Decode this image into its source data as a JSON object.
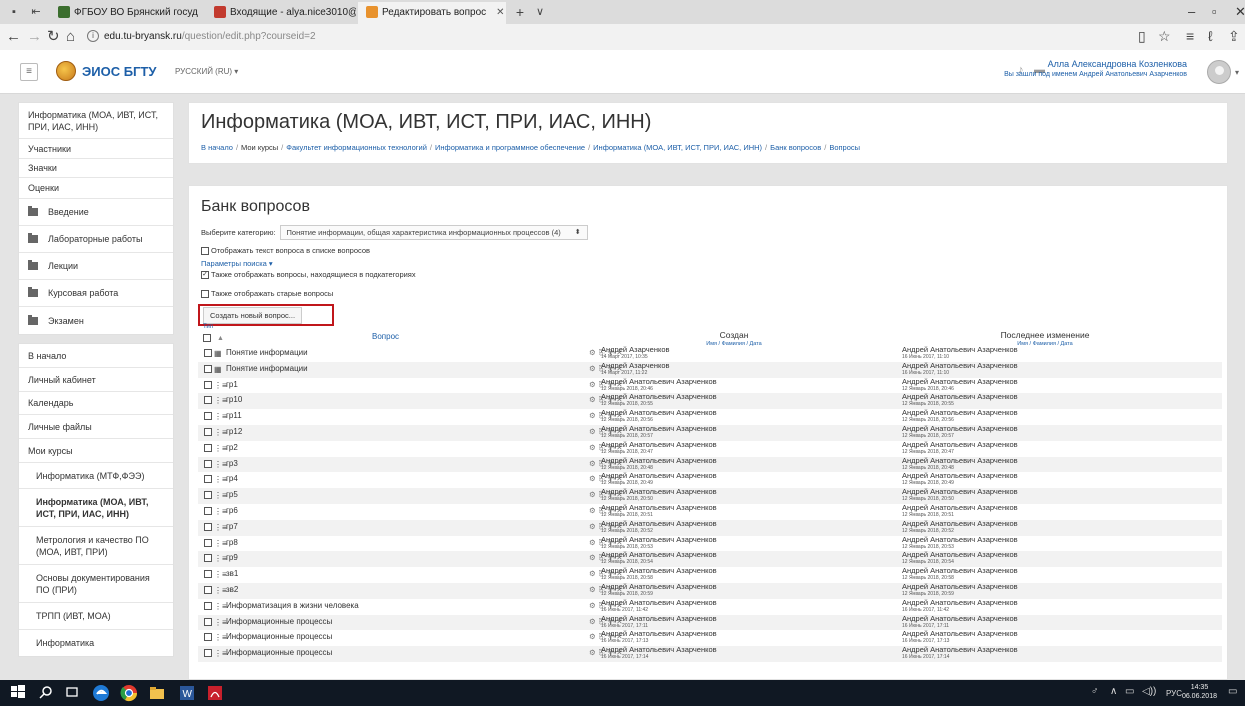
{
  "browser": {
    "tabs": [
      {
        "label": "ФГБОУ ВО Брянский госуд",
        "color": "#3b6e2e"
      },
      {
        "label": "Входящие - alya.nice3010@",
        "color": "#c23a2e"
      },
      {
        "label": "Редактировать вопрос",
        "color": "#e8922d"
      }
    ],
    "new_tab": "+",
    "tab_menu": "∨",
    "url_host": "edu.tu-bryansk.ru",
    "url_path": "/question/edit.php?courseid=2"
  },
  "navbar": {
    "menu_icon": "≡",
    "site_name": "ЭИОС БГТУ",
    "language": "РУССКИЙ (RU) ▾",
    "user_name": "Алла Александровна Козленкова",
    "logged_as": "Вы зашли под именем Андрей Анатольевич Азарченков"
  },
  "sidebar": {
    "course_block": [
      {
        "label": "Информатика (МОА, ИВТ, ИСТ, ПРИ, ИАС, ИНН)",
        "folder": false
      },
      {
        "label": "Участники",
        "folder": false
      },
      {
        "label": "Значки",
        "folder": false
      },
      {
        "label": "Оценки",
        "folder": false
      },
      {
        "label": "Введение",
        "folder": true
      },
      {
        "label": "Лабораторные работы",
        "folder": true
      },
      {
        "label": "Лекции",
        "folder": true
      },
      {
        "label": "Курсовая работа",
        "folder": true
      },
      {
        "label": "Экзамен",
        "folder": true
      }
    ],
    "site_block": [
      {
        "label": "В начало",
        "sub": false,
        "bold": false
      },
      {
        "label": "Личный кабинет",
        "sub": false,
        "bold": false
      },
      {
        "label": "Календарь",
        "sub": false,
        "bold": false
      },
      {
        "label": "Личные файлы",
        "sub": false,
        "bold": false
      },
      {
        "label": "Мои курсы",
        "sub": false,
        "bold": false
      },
      {
        "label": "Информатика (МТФ,ФЭЭ)",
        "sub": true,
        "bold": false
      },
      {
        "label": "Информатика (МОА, ИВТ, ИСТ, ПРИ, ИАС, ИНН)",
        "sub": true,
        "bold": true
      },
      {
        "label": "Метрология и качество ПО (МОА, ИВТ, ПРИ)",
        "sub": true,
        "bold": false
      },
      {
        "label": "Основы документирования ПО (ПРИ)",
        "sub": true,
        "bold": false
      },
      {
        "label": "ТРПП (ИВТ, МОА)",
        "sub": true,
        "bold": false
      },
      {
        "label": "Информатика",
        "sub": true,
        "bold": false
      }
    ]
  },
  "header": {
    "title": "Информатика (МОА, ИВТ, ИСТ, ПРИ, ИАС, ИНН)",
    "breadcrumb": [
      "В начало",
      "Мои курсы",
      "Факультет информационных технологий",
      "Информатика и программное обеспечение",
      "Информатика (МОА, ИВТ, ИСТ, ПРИ, ИАС, ИНН)",
      "Банк вопросов",
      "Вопросы"
    ]
  },
  "bank": {
    "title": "Банк вопросов",
    "category_label": "Выберите категорию:",
    "category_value": "Понятие информации, общая характеристика информационных процессов (4)",
    "show_text": "Отображать текст вопроса в списке вопросов",
    "search_params": "Параметры поиска ▾",
    "include_sub": "Также отображать вопросы, находящиеся в подкатегориях",
    "include_old": "Также отображать старые вопросы",
    "create_button": "Создать новый вопрос...",
    "col_type": "Тип",
    "col_question": "Вопрос",
    "col_created": "Создан",
    "col_created_sub": "Имя / Фамилия / Дата",
    "col_modified": "Последнее изменение",
    "col_modified_sub": "Имя / Фамилия / Дата"
  },
  "questions": [
    {
      "name": "Понятие информации",
      "type": "ddwtos",
      "created_by": "Андрей Азарченков",
      "created": "14 Март 2017, 10:35",
      "modified_by": "Андрей Анатольевич Азарченков",
      "modified": "16 Июнь 2017, 11:10"
    },
    {
      "name": "Понятие информации",
      "type": "ddwtos",
      "created_by": "Андрей Азарченков",
      "created": "14 Март 2017, 11:22",
      "modified_by": "Андрей Анатольевич Азарченков",
      "modified": "16 Июнь 2017, 11:10"
    },
    {
      "name": "гр1",
      "type": "match",
      "created_by": "Андрей Анатольевич Азарченков",
      "created": "12 Январь 2018, 20:46",
      "modified_by": "Андрей Анатольевич Азарченков",
      "modified": "12 Январь 2018, 20:46"
    },
    {
      "name": "гр10",
      "type": "match",
      "created_by": "Андрей Анатольевич Азарченков",
      "created": "12 Январь 2018, 20:55",
      "modified_by": "Андрей Анатольевич Азарченков",
      "modified": "12 Январь 2018, 20:55"
    },
    {
      "name": "гр11",
      "type": "match",
      "created_by": "Андрей Анатольевич Азарченков",
      "created": "12 Январь 2018, 20:56",
      "modified_by": "Андрей Анатольевич Азарченков",
      "modified": "12 Январь 2018, 20:56"
    },
    {
      "name": "гр12",
      "type": "match",
      "created_by": "Андрей Анатольевич Азарченков",
      "created": "12 Январь 2018, 20:57",
      "modified_by": "Андрей Анатольевич Азарченков",
      "modified": "12 Январь 2018, 20:57"
    },
    {
      "name": "гр2",
      "type": "match",
      "created_by": "Андрей Анатольевич Азарченков",
      "created": "12 Январь 2018, 20:47",
      "modified_by": "Андрей Анатольевич Азарченков",
      "modified": "12 Январь 2018, 20:47"
    },
    {
      "name": "гр3",
      "type": "match",
      "created_by": "Андрей Анатольевич Азарченков",
      "created": "12 Январь 2018, 20:48",
      "modified_by": "Андрей Анатольевич Азарченков",
      "modified": "12 Январь 2018, 20:48"
    },
    {
      "name": "гр4",
      "type": "match",
      "created_by": "Андрей Анатольевич Азарченков",
      "created": "12 Январь 2018, 20:49",
      "modified_by": "Андрей Анатольевич Азарченков",
      "modified": "12 Январь 2018, 20:49"
    },
    {
      "name": "гр5",
      "type": "match",
      "created_by": "Андрей Анатольевич Азарченков",
      "created": "12 Январь 2018, 20:50",
      "modified_by": "Андрей Анатольевич Азарченков",
      "modified": "12 Январь 2018, 20:50"
    },
    {
      "name": "гр6",
      "type": "match",
      "created_by": "Андрей Анатольевич Азарченков",
      "created": "12 Январь 2018, 20:51",
      "modified_by": "Андрей Анатольевич Азарченков",
      "modified": "12 Январь 2018, 20:51"
    },
    {
      "name": "гр7",
      "type": "match",
      "created_by": "Андрей Анатольевич Азарченков",
      "created": "12 Январь 2018, 20:52",
      "modified_by": "Андрей Анатольевич Азарченков",
      "modified": "12 Январь 2018, 20:52"
    },
    {
      "name": "гр8",
      "type": "match",
      "created_by": "Андрей Анатольевич Азарченков",
      "created": "12 Январь 2018, 20:53",
      "modified_by": "Андрей Анатольевич Азарченков",
      "modified": "12 Январь 2018, 20:53"
    },
    {
      "name": "гр9",
      "type": "match",
      "created_by": "Андрей Анатольевич Азарченков",
      "created": "12 Январь 2018, 20:54",
      "modified_by": "Андрей Анатольевич Азарченков",
      "modified": "12 Январь 2018, 20:54"
    },
    {
      "name": "зв1",
      "type": "match",
      "created_by": "Андрей Анатольевич Азарченков",
      "created": "12 Январь 2018, 20:58",
      "modified_by": "Андрей Анатольевич Азарченков",
      "modified": "12 Январь 2018, 20:58"
    },
    {
      "name": "зв2",
      "type": "match",
      "created_by": "Андрей Анатольевич Азарченков",
      "created": "12 Январь 2018, 20:59",
      "modified_by": "Андрей Анатольевич Азарченков",
      "modified": "12 Январь 2018, 20:59"
    },
    {
      "name": "Информатизация в жизни человека",
      "type": "match",
      "created_by": "Андрей Анатольевич Азарченков",
      "created": "16 Июнь 2017, 11:42",
      "modified_by": "Андрей Анатольевич Азарченков",
      "modified": "16 Июнь 2017, 11:42"
    },
    {
      "name": "Информационные процессы",
      "type": "match",
      "created_by": "Андрей Анатольевич Азарченков",
      "created": "16 Июнь 2017, 17:11",
      "modified_by": "Андрей Анатольевич Азарченков",
      "modified": "16 Июнь 2017, 17:11"
    },
    {
      "name": "Информационные процессы",
      "type": "match",
      "created_by": "Андрей Анатольевич Азарченков",
      "created": "16 Июнь 2017, 17:13",
      "modified_by": "Андрей Анатольевич Азарченков",
      "modified": "16 Июнь 2017, 17:13"
    },
    {
      "name": "Информационные процессы",
      "type": "match",
      "created_by": "Андрей Анатольевич Азарченков",
      "created": "16 Июнь 2017, 17:14",
      "modified_by": "Андрей Анатольевич Азарченков",
      "modified": "16 Июнь 2017, 17:14"
    }
  ],
  "taskbar": {
    "tray_language": "РУС",
    "time": "14:35",
    "date": "06.06.2018"
  }
}
